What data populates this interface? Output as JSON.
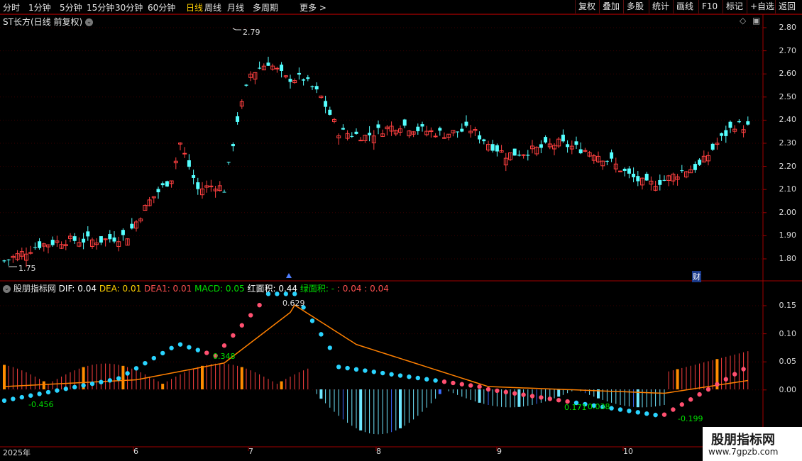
{
  "toolbar": {
    "periods": [
      "分时",
      "1分钟",
      "5分钟",
      "15分钟",
      "30分钟",
      "60分钟",
      "日线",
      "周线",
      "月线",
      "多周期",
      "更多 >"
    ],
    "active_period": "日线",
    "right_buttons": [
      "复权",
      "叠加",
      "多股",
      "统计",
      "画线",
      "F10",
      "标记",
      "+自选",
      "返回"
    ]
  },
  "main_chart": {
    "title": "ST长方",
    "subtitle": "(日线 前复权)",
    "high_label": "2.79",
    "low_label": "1.75",
    "price_ticks": [
      "2.80",
      "2.70",
      "2.60",
      "2.50",
      "2.40",
      "2.30",
      "2.20",
      "2.10",
      "2.00",
      "1.90",
      "1.80"
    ],
    "finance_badge": "财"
  },
  "indicator": {
    "name": "股朋指标网",
    "legend": [
      {
        "label": "DIF: 0.04",
        "color": "#ffffff"
      },
      {
        "label": "DEA: 0.01",
        "color": "#ffd000"
      },
      {
        "label": "DEA1: 0.01",
        "color": "#ff5050"
      },
      {
        "label": "MACD: 0.05",
        "color": "#00e000"
      },
      {
        "label": "红面积: 0.44",
        "color": "#ffffff"
      },
      {
        "label": "绿面积: -",
        "color": "#00e000"
      },
      {
        "label": ": 0.04",
        "color": "#ff5050"
      },
      {
        "label": ": 0.04",
        "color": "#ff5050"
      }
    ],
    "ticks": [
      "0.15",
      "0.10",
      "0.05",
      "0.00"
    ],
    "annotations": [
      "0.629",
      "0.348",
      "-0.456",
      "-0.199",
      "0.171",
      "0.038"
    ]
  },
  "time_axis": [
    "2025年",
    "6",
    "7",
    "8",
    "9",
    "10"
  ],
  "watermark": {
    "title": "股朋指标网",
    "url": "www.7gpzb.com"
  },
  "colors": {
    "up": "#ff4040",
    "down": "#54ffff",
    "axis": "#a00000",
    "dea": "#ff8000"
  }
}
